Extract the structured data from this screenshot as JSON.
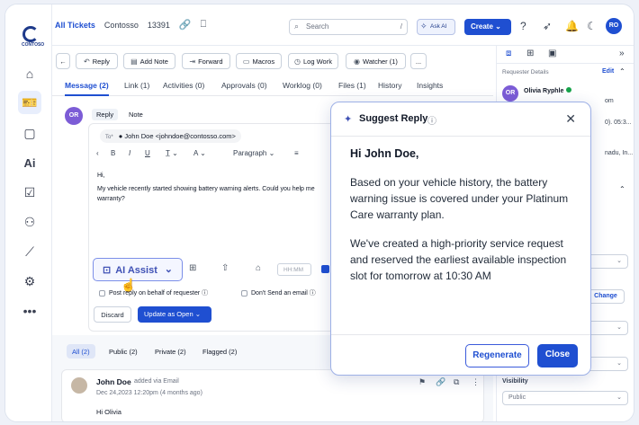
{
  "breadcrumb": {
    "all_tickets": "All Tickets",
    "company": "Contosso",
    "ticket_id": "13391"
  },
  "logo": {
    "text": "CONTOSO"
  },
  "search": {
    "placeholder": "Search",
    "shortcut": "/"
  },
  "ask_ai": {
    "label": "Ask AI"
  },
  "create": {
    "label": "Create"
  },
  "user_avatar": {
    "initials": "RO"
  },
  "nav": {
    "ai_label": "Ai"
  },
  "toolbar": {
    "reply": "Reply",
    "add_note": "Add Note",
    "forward": "Forward",
    "macros": "Macros",
    "log_work": "Log Work",
    "watcher": "Watcher (1)",
    "more": "..."
  },
  "tabs": [
    {
      "label": "Message (2)"
    },
    {
      "label": "Link (1)"
    },
    {
      "label": "Activities (0)"
    },
    {
      "label": "Approvals (0)"
    },
    {
      "label": "Worklog (0)"
    },
    {
      "label": "Files (1)"
    },
    {
      "label": "History"
    },
    {
      "label": "Insights"
    }
  ],
  "composer": {
    "avatar": "OR",
    "reply_tab": "Reply",
    "note_tab": "Note",
    "to_label": "To*",
    "to_value": "John Doe <johndoe@contosso.com>",
    "paragraph": "Paragraph",
    "greeting": "Hi,",
    "body": "My vehicle recently started showing battery warning alerts. Could you help me",
    "body2": "warranty?",
    "ai_assist": "AI Assist",
    "hhmm": "HH:MM",
    "post_reply": "Post reply on behalf of requester",
    "dont_send": "Don't Send an email",
    "discard": "Discard",
    "update": "Update as Open"
  },
  "filters": [
    {
      "label": "All (2)"
    },
    {
      "label": "Public (2)"
    },
    {
      "label": "Private (2)"
    },
    {
      "label": "Flagged (2)"
    }
  ],
  "note": {
    "author": "John Doe",
    "via": "added via Email",
    "date": "Dec 24,2023 12:20pm (4 months ago)",
    "greeting": "Hi Olivia"
  },
  "right_panel": {
    "label": "Requester Details",
    "edit": "Edit",
    "avatar": "OR",
    "name": "Olivia Ryphle",
    "frag1": "om",
    "frag2": "0). 05:3...",
    "frag3": "nadu, In...",
    "change": "Change",
    "visibility_label": "Visibility",
    "visibility_value": "Public"
  },
  "modal": {
    "title": "Suggest Reply",
    "greeting": "Hi John Doe,",
    "para1": "Based on your vehicle history, the battery warning issue is covered under your Platinum Care warranty plan.",
    "para2": "We've created a high-priority service request and reserved the earliest available inspection slot for tomorrow at 10:30 AM",
    "regenerate": "Regenerate",
    "close": "Close"
  },
  "colors": {
    "accent": "#1f4fd1",
    "avatar_purple": "#7c5cd6",
    "status_green": "#16a34a"
  }
}
